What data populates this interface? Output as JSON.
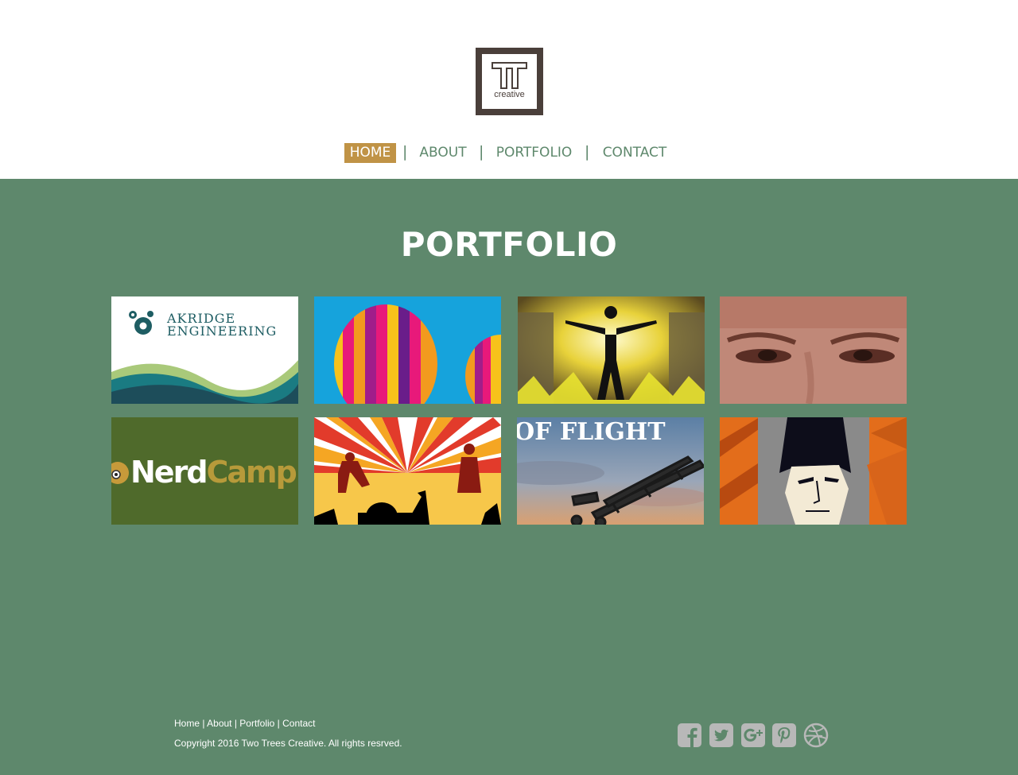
{
  "brand": {
    "logo_letters": "TT",
    "logo_word": "creative"
  },
  "nav": {
    "items": [
      {
        "label": "HOME",
        "active": true
      },
      {
        "label": "ABOUT",
        "active": false
      },
      {
        "label": "PORTFOLIO",
        "active": false
      },
      {
        "label": "CONTACT",
        "active": false
      }
    ],
    "separator": "|"
  },
  "main": {
    "title": "PORTFOLIO",
    "portfolio": [
      {
        "subject": "akridge-engineering",
        "text_line1": "AKRIDGE",
        "text_line2": "ENGINEERING"
      },
      {
        "subject": "hot-air-balloons"
      },
      {
        "subject": "silhouette-figure"
      },
      {
        "subject": "eyes-closeup"
      },
      {
        "subject": "nerd-camp",
        "text": "NerdCamp"
      },
      {
        "subject": "concert-silhouettes"
      },
      {
        "subject": "flight-biplane",
        "text": "OF FLIGHT"
      },
      {
        "subject": "poster-face"
      }
    ]
  },
  "footer": {
    "links": [
      "Home",
      "About",
      "Portfolio",
      "Contact"
    ],
    "separator": " | ",
    "copyright": "Copyright 2016 Two Trees Creative. All rights resrved.",
    "social": [
      "facebook-icon",
      "twitter-icon",
      "google-plus-icon",
      "pinterest-icon",
      "dribbble-icon"
    ]
  },
  "colors": {
    "brand_green": "#5e886c",
    "accent_gold": "#c09346",
    "logo_brown": "#4a3f3a",
    "social_gray": "#b8b8b8"
  }
}
